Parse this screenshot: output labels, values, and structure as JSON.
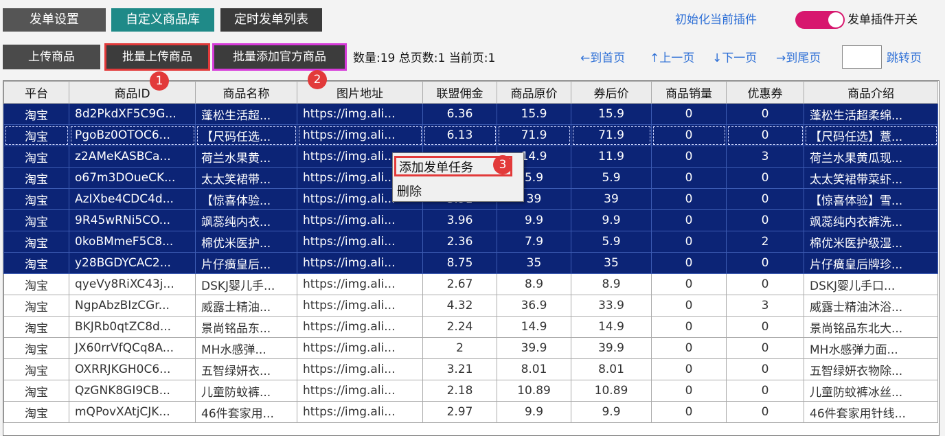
{
  "tabs": [
    "发单设置",
    "自定义商品库",
    "定时发单列表"
  ],
  "header": {
    "init_link": "初始化当前插件",
    "toggle_label": "发单插件开关",
    "toggle_on": true,
    "accent": "#d7176e"
  },
  "toolbar": {
    "upload": "上传商品",
    "batch_upload": "批量上传商品",
    "batch_official": "批量添加官方商品",
    "stats": "数量:19 总页数:1 当前页:1",
    "first": "←到首页",
    "prev": "↑上一页",
    "next": "↓下一页",
    "last": "→到尾页",
    "page_value": "",
    "jump": "跳转页"
  },
  "badges": [
    "1",
    "2",
    "3"
  ],
  "table": {
    "columns": [
      "平台",
      "商品ID",
      "商品名称",
      "图片地址",
      "联盟佣金",
      "商品原价",
      "券后价",
      "商品销量",
      "优惠券",
      "商品介绍"
    ],
    "rows": [
      [
        "淘宝",
        "8d2PkdXF5C9G...",
        "蓬松生活超...",
        "https://img.ali...",
        "6.36",
        "15.9",
        "15.9",
        "0",
        "0",
        "蓬松生活超柔绵..."
      ],
      [
        "淘宝",
        "PgoBz0OTOC6...",
        "【尺码任选...",
        "https://img.ali...",
        "6.13",
        "71.9",
        "71.9",
        "0",
        "0",
        "【尺码任选】薏..."
      ],
      [
        "淘宝",
        "z2AMeKASBCa...",
        "荷兰水果黄...",
        "https://img.ali...",
        "",
        "14.9",
        "11.9",
        "0",
        "3",
        "荷兰水果黄瓜现..."
      ],
      [
        "淘宝",
        "o67m3DOueCK...",
        "太太笑裙带...",
        "https://img.ali...",
        "",
        "5.9",
        "5.9",
        "0",
        "0",
        "太太笑裙带菜虾..."
      ],
      [
        "淘宝",
        "AzIXbe4CDC4d...",
        "【惊喜体验...",
        "https://img.ali...",
        "3.91",
        "39",
        "39",
        "0",
        "0",
        "【惊喜体验】雪..."
      ],
      [
        "淘宝",
        "9R45wRNi5CO...",
        "飒蕊纯内衣...",
        "https://img.ali...",
        "3.96",
        "9.9",
        "9.9",
        "0",
        "0",
        "飒蕊纯内衣裤洗..."
      ],
      [
        "淘宝",
        "0koBMmeF5C8...",
        "棉优米医护...",
        "https://img.ali...",
        "2.36",
        "7.9",
        "5.9",
        "0",
        "2",
        "棉优米医护级湿..."
      ],
      [
        "淘宝",
        "y28BGDYCAC2...",
        "片仔癀皇后...",
        "https://img.ali...",
        "8.75",
        "35",
        "35",
        "0",
        "0",
        "片仔癀皇后牌珍..."
      ],
      [
        "淘宝",
        "qyeVy8RiXC43j...",
        "DSKJ婴儿手...",
        "https://img.ali...",
        "2.67",
        "8.9",
        "8.9",
        "0",
        "0",
        "DSKJ婴儿手口..."
      ],
      [
        "淘宝",
        "NgpAbzBIzCGr...",
        "威露士精油...",
        "https://img.ali...",
        "4.32",
        "36.9",
        "33.9",
        "0",
        "3",
        "威露士精油沐浴..."
      ],
      [
        "淘宝",
        "BKJRb0qtZC8d...",
        "景尚铭品东...",
        "https://img.ali...",
        "2.24",
        "14.9",
        "14.9",
        "0",
        "0",
        "景尚铭品东北大..."
      ],
      [
        "淘宝",
        "JX60rrVfQCq8A...",
        "MH水感弹...",
        "https://img.ali...",
        "2",
        "39.9",
        "39.9",
        "0",
        "0",
        "MH水感弹力面..."
      ],
      [
        "淘宝",
        "OXRRJKGH0C6...",
        "五智绿妍衣...",
        "https://img.ali...",
        "3.21",
        "8.01",
        "8.01",
        "0",
        "0",
        "五智绿妍衣物除..."
      ],
      [
        "淘宝",
        "QzGNK8GI9CB...",
        "儿童防蚊裤...",
        "https://img.ali...",
        "2.18",
        "10.89",
        "10.89",
        "0",
        "0",
        "儿童防蚊裤冰丝..."
      ],
      [
        "淘宝",
        "mQPovXAtjCJK...",
        "46件套家用...",
        "https://img.ali...",
        "2.97",
        "9.9",
        "9.9",
        "0",
        "0",
        "46件套家用针线..."
      ]
    ],
    "selected_count": 8,
    "selected_color": "#0c2476"
  },
  "context_menu": {
    "items": [
      "添加发单任务",
      "删除"
    ]
  }
}
